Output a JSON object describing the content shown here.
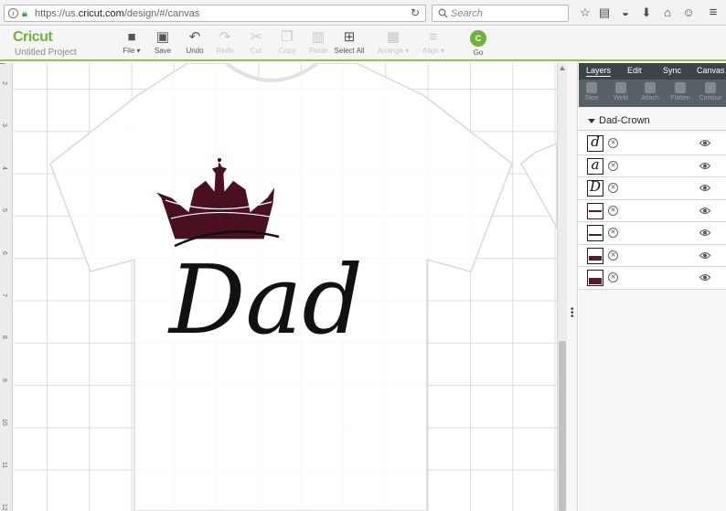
{
  "browser": {
    "url_prefix": "https://us.",
    "url_domain": "cricut.com",
    "url_path": "/design/#/canvas",
    "search_placeholder": "Search"
  },
  "app": {
    "logo": "Cricut",
    "project_name": "Untitled Project",
    "accent": "#8dc63f",
    "toolbar": [
      {
        "label": "File ▾",
        "icon": "folder-icon",
        "enabled": true
      },
      {
        "label": "Save",
        "icon": "save-icon",
        "enabled": true
      },
      {
        "label": "Undo",
        "icon": "undo-icon",
        "enabled": true
      },
      {
        "label": "Redo",
        "icon": "redo-icon",
        "enabled": false
      },
      {
        "label": "Cut",
        "icon": "cut-icon",
        "enabled": false
      },
      {
        "label": "Copy",
        "icon": "copy-icon",
        "enabled": false
      },
      {
        "label": "Paste",
        "icon": "paste-icon",
        "enabled": false
      },
      {
        "label": "Select All",
        "icon": "select-all-icon",
        "enabled": true
      },
      {
        "label": "Arrange ▾",
        "icon": "arrange-icon",
        "enabled": false
      },
      {
        "label": "Align ▾",
        "icon": "align-icon",
        "enabled": false
      }
    ],
    "go": {
      "badge": "C",
      "label": "Go"
    }
  },
  "ruler": {
    "numbers": [
      "2",
      "3",
      "4",
      "5",
      "6",
      "7",
      "8",
      "9",
      "10",
      "11",
      "12"
    ]
  },
  "canvas": {
    "design_text": "Dad",
    "crown_color": "#4a1020"
  },
  "panel": {
    "tabs": [
      "Layers",
      "Edit",
      "Sync",
      "Canvas"
    ],
    "active_tab": "Layers",
    "tools": [
      "Slice",
      "Weld",
      "Attach",
      "Flatten",
      "Contour"
    ],
    "group_name": "Dad-Crown",
    "layers": [
      {
        "thumb": "d",
        "icon": "letter-d-layer"
      },
      {
        "thumb": "a",
        "icon": "letter-a-layer"
      },
      {
        "thumb": "D",
        "icon": "letter-D-layer"
      },
      {
        "thumb": "",
        "icon": "crown-band-layer"
      },
      {
        "thumb": "",
        "icon": "crown-band-layer"
      },
      {
        "thumb": "",
        "icon": "crown-top-layer"
      },
      {
        "thumb": "",
        "icon": "crown-layer"
      }
    ]
  }
}
